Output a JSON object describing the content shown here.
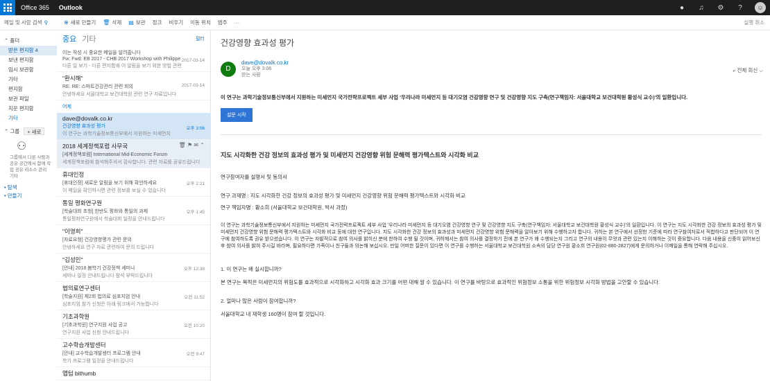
{
  "topbar": {
    "brand": "Office 365",
    "app": "Outlook",
    "icons": [
      "skype-icon",
      "bell-icon",
      "gear-icon",
      "help-icon"
    ],
    "help": "?"
  },
  "cmdbar": {
    "search": "메일 및 사람 검색",
    "new": "새로 만들기",
    "delete": "삭제",
    "archive": "보관",
    "junk": "정크",
    "sweep": "비우기",
    "move": "이동 위치",
    "categories": "범주",
    "more": "···",
    "undo": "실행 취소"
  },
  "leftnav": {
    "folders_head": "폴더",
    "folders": [
      "받은 편지함 4",
      "보낸 편지함",
      "임시 보관함",
      "기타",
      "편지함",
      "보관 파일",
      "지운 편지함",
      "기타"
    ],
    "groups_head": "그룹",
    "new_btn": "+ 새로",
    "group_text": "그룹에서 다른 사람과 공유 공간에서 함께 작업 공유 리소스 관리 기타",
    "extra": [
      "• 탐색",
      "• 만들기"
    ]
  },
  "tabs": {
    "focused": "중요",
    "other": "기타",
    "filter": "필터"
  },
  "messages": [
    {
      "sender": "이는 작성 시 중요한 메일을 알려줍니다",
      "subj": "Fw: Fwd: EB 2017 - CHB 2017 Workshop with Philippe",
      "prev": "다른 일 보기 - 다른 편지함에 이 알림을 보기 위한 방법 관련",
      "time": "2017-03-14"
    },
    {
      "sender": "\"환시해\"",
      "subj": "RE: RE: 스마트건강관리 관련 회의",
      "prev": "안녕하세요 서울대학교 보건대학원 관련 연구 자료입니다",
      "time": "2017-03-14"
    },
    {
      "sender": "dave@dovalk.co.kr",
      "subj": "건강영향 효과성 평가",
      "prev": "이 연구는 과학기술정보통신부에서 지원하는 미세먼지",
      "time": "오후 3:06"
    },
    {
      "sender": "2018 세계정책포럼 사무국",
      "subj": "[세계정책포럼] International Mid-Economic Forum",
      "prev": "세계정책포럼에 참석해주셔서 감사합니다. 관련 자료를 공유드립니다",
      "time": ""
    },
    {
      "sender": "휴대인정",
      "subj": "[휴대인정] 새로운 알림을 보기 위해 확인하세요",
      "prev": "이 메일을 확인하시면 관련 정보를 보실 수 있습니다",
      "time": "오후 2:21"
    },
    {
      "sender": "통일 평화연구원",
      "subj": "[학술대회 초청] 한반도 평화와 통일의 과제",
      "prev": "통일평화연구원에서 학술대회 일정을 안내드립니다",
      "time": "오후 1:45"
    },
    {
      "sender": "\"이영희\"",
      "subj": "[자료요청] 건강영향평가 관련 문의",
      "prev": "안녕하세요 연구 자료 관련하여 문의 드립니다",
      "time": ""
    },
    {
      "sender": "\"김성민\"",
      "subj": "[안내] 2018 봄학기 건강정책 세미나",
      "prev": "세미나 일정 안내드립니다 참석 부탁드립니다",
      "time": "오후 12:38"
    },
    {
      "sender": "법의료연구센터",
      "subj": "[학술지원] 제2회 법의료 심포지엄 안내",
      "prev": "심포지엄 참가 신청은 아래 링크에서 가능합니다",
      "time": "오전 11:52"
    },
    {
      "sender": "기초과학원",
      "subj": "[기초과학원] 연구지원 사업 공고",
      "prev": "연구지원 사업 신청 안내드립니다",
      "time": "오전 10:20"
    },
    {
      "sender": "고수학습개발센터",
      "subj": "[안내] 교수학습개발센터 프로그램 안내",
      "prev": "학기 프로그램 일정을 안내드립니다",
      "time": "오전 9:47"
    },
    {
      "sender": "앱텀 bithumb",
      "subj": "",
      "prev": "",
      "time": ""
    }
  ],
  "message_date_header": "어제",
  "pane": {
    "subject": "건강영향 효과성 평가",
    "from_initial": "D",
    "from_email": "dave@dovalk.co.kr",
    "from_meta1": "오늘 오후 3:06",
    "from_meta2": "받는 사람",
    "reply_all": "전체 회신",
    "intro": "이 연구는 과학기술정보통신부에서 지원하는 미세먼지 국가전략프로젝트 세부 사업 '우리나라 미세먼지 등 대기오염 건강영향 연구 및 건강영향 지도 구축(연구책임자: 서울대학교 보건대학원 황성식 교수)'의 일환입니다.",
    "cta": "설문 시작",
    "h2": "지도 시각화한 건강 정보의 효과성 평가 및 미세먼지 건강영향 위험 문해력 평가텍스트와 시각화 비교",
    "greeting": "연구참여자를 설명서 및 동의서",
    "title_line": "연구 과제명 : 지도 시각화한 건강 정보의 효과성 평가 및 미세먼지 건강영향 위험 문해력 평가텍스트와 시각화 비교",
    "pi_line": "연구 책임자명 : 황소희 (서울대학교 보건대학원, 박사 과정)",
    "long_p": "이 연구는 과학기술정보통신부에서 지원하는 미세먼지 국가전략프로젝트 세부 사업 '우리나라 미세먼지 등 대기오염 건강영향 연구 및 건강영향 지도 구축(연구책임자: 서울대학교 보건대학원 황성식 교수)'의 일환입니다. 이 연구는 지도 시각화한 건강 정보의 효과성 평가 및 미세먼지 건강영향 위험 문해력 평가텍스트와 시각화 비교 등에 대한 연구입니다. 지도 시각화한 건강 정보의 효과성과 미세먼지 건강영향 위험 문해력을 알아보기 위해 수행하고자 합니다. 귀하는 본 연구에서 선정한 기준에 따라 연구참여자로서 적합하다고 판단되어 이 연구에 참여하도록 권유 받으셨습니다. 이 연구는 자발적으로 참여 의사를 밝히신 분에 한하여 수행 될 것이며, 귀하께서는 참여 의사를 결정하기 전에 본 연구가 왜 수행되는지 그리고 연구의 내용이 무엇과 관련 있는지 이해하는 것이 중요합니다. 다음 내용을 신중히 읽어보신 후 참여 의사를 밝혀 주시길 바라며, 필요하다면 가족이나 친구들과 의논해 보십시오. 만일 어떠한 질문이 있다면 이 연구를 수행하는 서울대학교 보건대학원 소속의 담당 연구원 황소희 연구원(02-880-2827)에게 문의하거나 이메일을 통해 연락해 주십시오.",
    "q1": "1. 이 연구는 왜 실시합니까?",
    "a1": "본 연구는 목적은 미세먼지의 위험도를 효과적으로 시각화하고 시각화 효과 크기를 어떤 대해 알 수 있습니다. 이 연구를 바탕으로 효과적인 위험정보 소통을 위한 위험정보 시각화 방법을 고안할 수 있습니다.",
    "q2": "2. 얼마나 많은 사람이 참여합니까?",
    "a2": "서울대학교 내 재학생 160명이 참여 할 것입니다."
  }
}
